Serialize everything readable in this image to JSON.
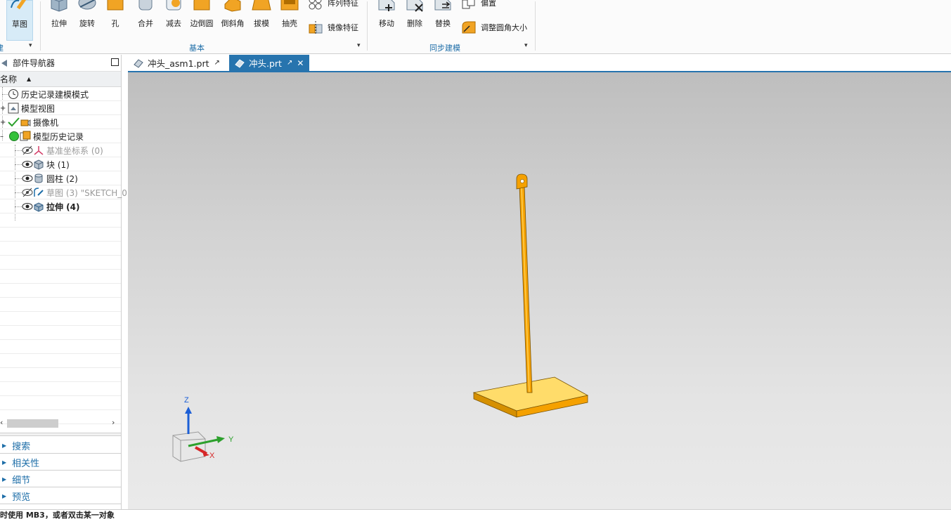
{
  "ribbon": {
    "sketch_group": {
      "left_partial_label": "面",
      "sketch_label": "草图",
      "group_partial_label": "建"
    },
    "basic_group": {
      "label": "基本",
      "buttons": [
        {
          "label": "拉伸"
        },
        {
          "label": "旋转"
        },
        {
          "label": "孔"
        },
        {
          "label": "合并"
        },
        {
          "label": "减去"
        },
        {
          "label": "边倒圆"
        },
        {
          "label": "倒斜角"
        },
        {
          "label": "拔模"
        },
        {
          "label": "抽壳"
        }
      ],
      "small_buttons": [
        {
          "label": "阵列特征"
        },
        {
          "label": "镜像特征"
        }
      ]
    },
    "sync_group": {
      "label": "同步建模",
      "buttons": [
        {
          "label": "移动"
        },
        {
          "label": "删除"
        },
        {
          "label": "替换"
        }
      ],
      "small_buttons": [
        {
          "label": "偏置"
        },
        {
          "label": "调整圆角大小"
        }
      ]
    }
  },
  "navigator": {
    "title": "部件导航器",
    "column_header": "名称",
    "rows": [
      {
        "label": "历史记录建模模式",
        "style": "normal"
      },
      {
        "label": "模型视图",
        "style": "normal"
      },
      {
        "label": "摄像机",
        "style": "normal"
      },
      {
        "label": "模型历史记录",
        "style": "normal"
      },
      {
        "label": "基准坐标系 (0)",
        "style": "dim"
      },
      {
        "label": "块 (1)",
        "style": "normal"
      },
      {
        "label": "圆柱 (2)",
        "style": "normal"
      },
      {
        "label": "草图 (3) \"SKETCH_0",
        "style": "dim"
      },
      {
        "label": "拉伸 (4)",
        "style": "bold"
      }
    ],
    "panels": [
      "搜索",
      "相关性",
      "细节",
      "预览"
    ]
  },
  "tabs": [
    {
      "label": "冲头_asm1.prt",
      "active": false
    },
    {
      "label": "冲头.prt",
      "active": true
    }
  ],
  "triad": {
    "x_label": "X",
    "y_label": "Y",
    "z_label": "Z"
  },
  "colors": {
    "accent": "#2774ae",
    "model_orange": "#f5a100",
    "model_top": "#ffd45a"
  },
  "status": {
    "text": "时使用 MB3，或者双击某一对象"
  }
}
